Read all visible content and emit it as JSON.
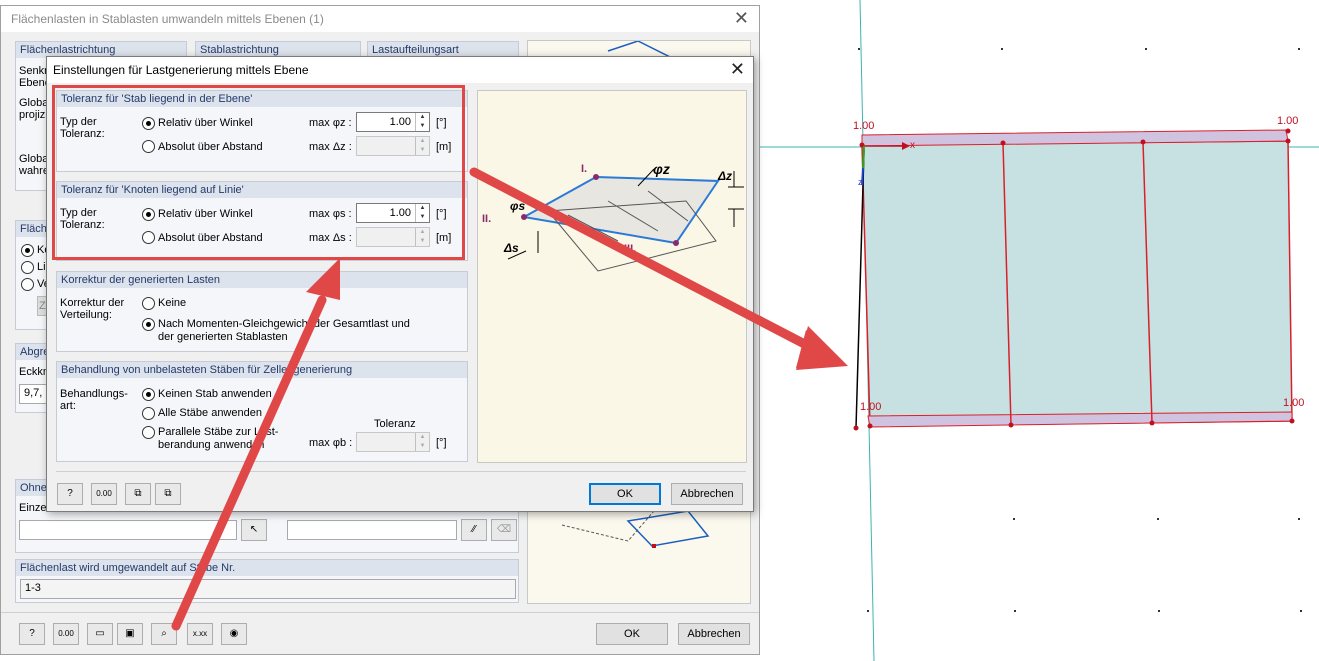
{
  "main_dialog": {
    "title": "Flächenlasten in Stablasten umwandeln mittels Ebenen   (1)",
    "tabs": [
      "Flächenlastrichtung",
      "Stablastrichtung",
      "Lastaufteilungsart"
    ],
    "left_snips": {
      "senkr": "Senkr",
      "ebene": "Ebene",
      "global1": "Global",
      "projizi": "projizi",
      "global2": "Global",
      "wahre": "wahre",
      "flaeche": "Fläch",
      "ko": "Ko",
      "lin": "Lin",
      "ve": "Ve",
      "z": "Z",
      "abgre": "Abgre",
      "eckkn": "Eckkno",
      "corner_nodes": "9,7,",
      "ohne": "Ohne",
      "einzel": "Einzel"
    },
    "converted_label": "Flächenlast wird umgewandelt auf Stäbe Nr.",
    "converted_value": "1-3",
    "ok": "OK",
    "cancel": "Abbrechen",
    "toolbar_icons": [
      "help-icon",
      "units-icon",
      "open-icon",
      "save-icon",
      "search-icon",
      "decimal-icon",
      "view-icon"
    ]
  },
  "sub_dialog": {
    "title": "Einstellungen für Lastgenerierung mittels Ebene",
    "group1": {
      "header": "Toleranz für 'Stab liegend in der Ebene'",
      "type_label": "Typ der Toleranz:",
      "option1": "Relativ über Winkel",
      "option2": "Absolut über Abstand",
      "max_phi_label": "max φz :",
      "max_phi_value": "1.00",
      "phi_unit": "[°]",
      "max_delta_label": "max Δz :",
      "delta_unit": "[m]"
    },
    "group2": {
      "header": "Toleranz für 'Knoten liegend auf Linie'",
      "type_label": "Typ der Toleranz:",
      "option1": "Relativ über Winkel",
      "option2": "Absolut über Abstand",
      "max_phi_label": "max φs :",
      "max_phi_value": "1.00",
      "phi_unit": "[°]",
      "max_delta_label": "max Δs :",
      "delta_unit": "[m]"
    },
    "group3": {
      "header": "Korrektur der generierten Lasten",
      "label": "Korrektur der Verteilung:",
      "option1": "Keine",
      "option2_line1": "Nach Momenten-Gleichgewicht der Gesamtlast und",
      "option2_line2": "der generierten Stablasten"
    },
    "group4": {
      "header": "Behandlung von unbelasteten Stäben für Zellengenerierung",
      "label": "Behandlungs-art:",
      "option1": "Keinen Stab anwenden",
      "option2": "Alle Stäbe anwenden",
      "option3_line1": "Parallele Stäbe zur Last-",
      "option3_line2": "berandung anwenden",
      "tol_header": "Toleranz",
      "max_phi_b": "max φb :",
      "unit": "[°]"
    },
    "ok": "OK",
    "cancel": "Abbrechen",
    "diagram_labels": {
      "n1": "I.",
      "n2": "II.",
      "n3": "III.",
      "phiz": "φz",
      "phis": "φs",
      "dz": "Δz",
      "ds": "Δs"
    }
  },
  "viewport": {
    "node_labels": [
      "1.00",
      "1.00",
      "1.00",
      "1.00"
    ],
    "axis_x": "x",
    "axis_z": "z",
    "colors": {
      "plate_fill": "#c7e1e2",
      "member": "#d9202a",
      "axis_line": "#3fb3b0",
      "annotation_arrow": "#e04848"
    }
  }
}
